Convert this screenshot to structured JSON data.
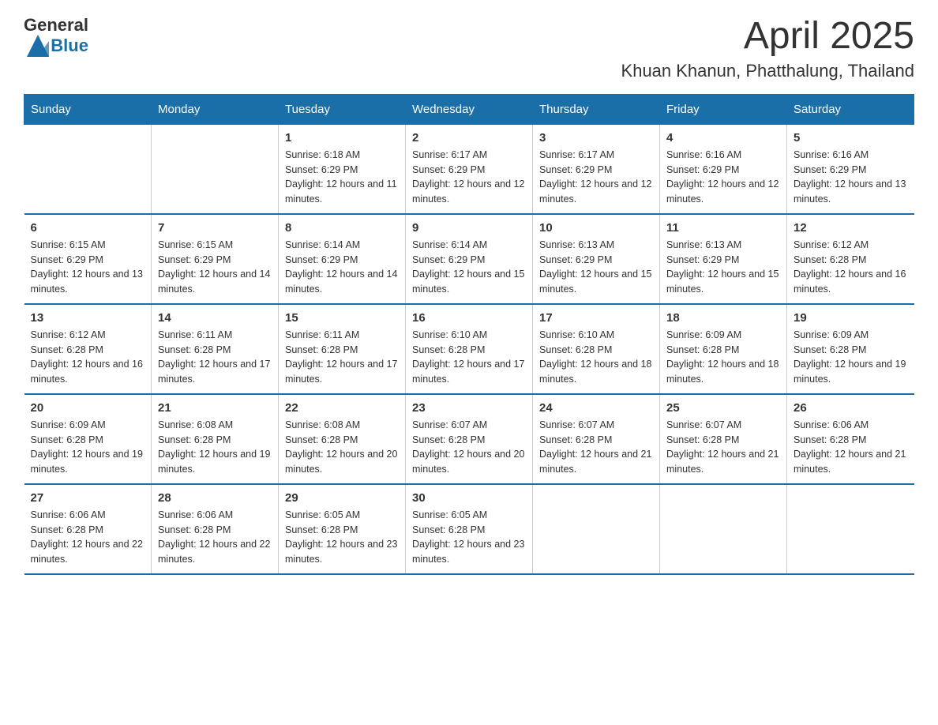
{
  "logo": {
    "text_general": "General",
    "text_blue": "Blue"
  },
  "title": {
    "month_year": "April 2025",
    "location": "Khuan Khanun, Phatthalung, Thailand"
  },
  "header_days": [
    "Sunday",
    "Monday",
    "Tuesday",
    "Wednesday",
    "Thursday",
    "Friday",
    "Saturday"
  ],
  "weeks": [
    [
      {
        "day": "",
        "sunrise": "",
        "sunset": "",
        "daylight": ""
      },
      {
        "day": "",
        "sunrise": "",
        "sunset": "",
        "daylight": ""
      },
      {
        "day": "1",
        "sunrise": "Sunrise: 6:18 AM",
        "sunset": "Sunset: 6:29 PM",
        "daylight": "Daylight: 12 hours and 11 minutes."
      },
      {
        "day": "2",
        "sunrise": "Sunrise: 6:17 AM",
        "sunset": "Sunset: 6:29 PM",
        "daylight": "Daylight: 12 hours and 12 minutes."
      },
      {
        "day": "3",
        "sunrise": "Sunrise: 6:17 AM",
        "sunset": "Sunset: 6:29 PM",
        "daylight": "Daylight: 12 hours and 12 minutes."
      },
      {
        "day": "4",
        "sunrise": "Sunrise: 6:16 AM",
        "sunset": "Sunset: 6:29 PM",
        "daylight": "Daylight: 12 hours and 12 minutes."
      },
      {
        "day": "5",
        "sunrise": "Sunrise: 6:16 AM",
        "sunset": "Sunset: 6:29 PM",
        "daylight": "Daylight: 12 hours and 13 minutes."
      }
    ],
    [
      {
        "day": "6",
        "sunrise": "Sunrise: 6:15 AM",
        "sunset": "Sunset: 6:29 PM",
        "daylight": "Daylight: 12 hours and 13 minutes."
      },
      {
        "day": "7",
        "sunrise": "Sunrise: 6:15 AM",
        "sunset": "Sunset: 6:29 PM",
        "daylight": "Daylight: 12 hours and 14 minutes."
      },
      {
        "day": "8",
        "sunrise": "Sunrise: 6:14 AM",
        "sunset": "Sunset: 6:29 PM",
        "daylight": "Daylight: 12 hours and 14 minutes."
      },
      {
        "day": "9",
        "sunrise": "Sunrise: 6:14 AM",
        "sunset": "Sunset: 6:29 PM",
        "daylight": "Daylight: 12 hours and 15 minutes."
      },
      {
        "day": "10",
        "sunrise": "Sunrise: 6:13 AM",
        "sunset": "Sunset: 6:29 PM",
        "daylight": "Daylight: 12 hours and 15 minutes."
      },
      {
        "day": "11",
        "sunrise": "Sunrise: 6:13 AM",
        "sunset": "Sunset: 6:29 PM",
        "daylight": "Daylight: 12 hours and 15 minutes."
      },
      {
        "day": "12",
        "sunrise": "Sunrise: 6:12 AM",
        "sunset": "Sunset: 6:28 PM",
        "daylight": "Daylight: 12 hours and 16 minutes."
      }
    ],
    [
      {
        "day": "13",
        "sunrise": "Sunrise: 6:12 AM",
        "sunset": "Sunset: 6:28 PM",
        "daylight": "Daylight: 12 hours and 16 minutes."
      },
      {
        "day": "14",
        "sunrise": "Sunrise: 6:11 AM",
        "sunset": "Sunset: 6:28 PM",
        "daylight": "Daylight: 12 hours and 17 minutes."
      },
      {
        "day": "15",
        "sunrise": "Sunrise: 6:11 AM",
        "sunset": "Sunset: 6:28 PM",
        "daylight": "Daylight: 12 hours and 17 minutes."
      },
      {
        "day": "16",
        "sunrise": "Sunrise: 6:10 AM",
        "sunset": "Sunset: 6:28 PM",
        "daylight": "Daylight: 12 hours and 17 minutes."
      },
      {
        "day": "17",
        "sunrise": "Sunrise: 6:10 AM",
        "sunset": "Sunset: 6:28 PM",
        "daylight": "Daylight: 12 hours and 18 minutes."
      },
      {
        "day": "18",
        "sunrise": "Sunrise: 6:09 AM",
        "sunset": "Sunset: 6:28 PM",
        "daylight": "Daylight: 12 hours and 18 minutes."
      },
      {
        "day": "19",
        "sunrise": "Sunrise: 6:09 AM",
        "sunset": "Sunset: 6:28 PM",
        "daylight": "Daylight: 12 hours and 19 minutes."
      }
    ],
    [
      {
        "day": "20",
        "sunrise": "Sunrise: 6:09 AM",
        "sunset": "Sunset: 6:28 PM",
        "daylight": "Daylight: 12 hours and 19 minutes."
      },
      {
        "day": "21",
        "sunrise": "Sunrise: 6:08 AM",
        "sunset": "Sunset: 6:28 PM",
        "daylight": "Daylight: 12 hours and 19 minutes."
      },
      {
        "day": "22",
        "sunrise": "Sunrise: 6:08 AM",
        "sunset": "Sunset: 6:28 PM",
        "daylight": "Daylight: 12 hours and 20 minutes."
      },
      {
        "day": "23",
        "sunrise": "Sunrise: 6:07 AM",
        "sunset": "Sunset: 6:28 PM",
        "daylight": "Daylight: 12 hours and 20 minutes."
      },
      {
        "day": "24",
        "sunrise": "Sunrise: 6:07 AM",
        "sunset": "Sunset: 6:28 PM",
        "daylight": "Daylight: 12 hours and 21 minutes."
      },
      {
        "day": "25",
        "sunrise": "Sunrise: 6:07 AM",
        "sunset": "Sunset: 6:28 PM",
        "daylight": "Daylight: 12 hours and 21 minutes."
      },
      {
        "day": "26",
        "sunrise": "Sunrise: 6:06 AM",
        "sunset": "Sunset: 6:28 PM",
        "daylight": "Daylight: 12 hours and 21 minutes."
      }
    ],
    [
      {
        "day": "27",
        "sunrise": "Sunrise: 6:06 AM",
        "sunset": "Sunset: 6:28 PM",
        "daylight": "Daylight: 12 hours and 22 minutes."
      },
      {
        "day": "28",
        "sunrise": "Sunrise: 6:06 AM",
        "sunset": "Sunset: 6:28 PM",
        "daylight": "Daylight: 12 hours and 22 minutes."
      },
      {
        "day": "29",
        "sunrise": "Sunrise: 6:05 AM",
        "sunset": "Sunset: 6:28 PM",
        "daylight": "Daylight: 12 hours and 23 minutes."
      },
      {
        "day": "30",
        "sunrise": "Sunrise: 6:05 AM",
        "sunset": "Sunset: 6:28 PM",
        "daylight": "Daylight: 12 hours and 23 minutes."
      },
      {
        "day": "",
        "sunrise": "",
        "sunset": "",
        "daylight": ""
      },
      {
        "day": "",
        "sunrise": "",
        "sunset": "",
        "daylight": ""
      },
      {
        "day": "",
        "sunrise": "",
        "sunset": "",
        "daylight": ""
      }
    ]
  ]
}
